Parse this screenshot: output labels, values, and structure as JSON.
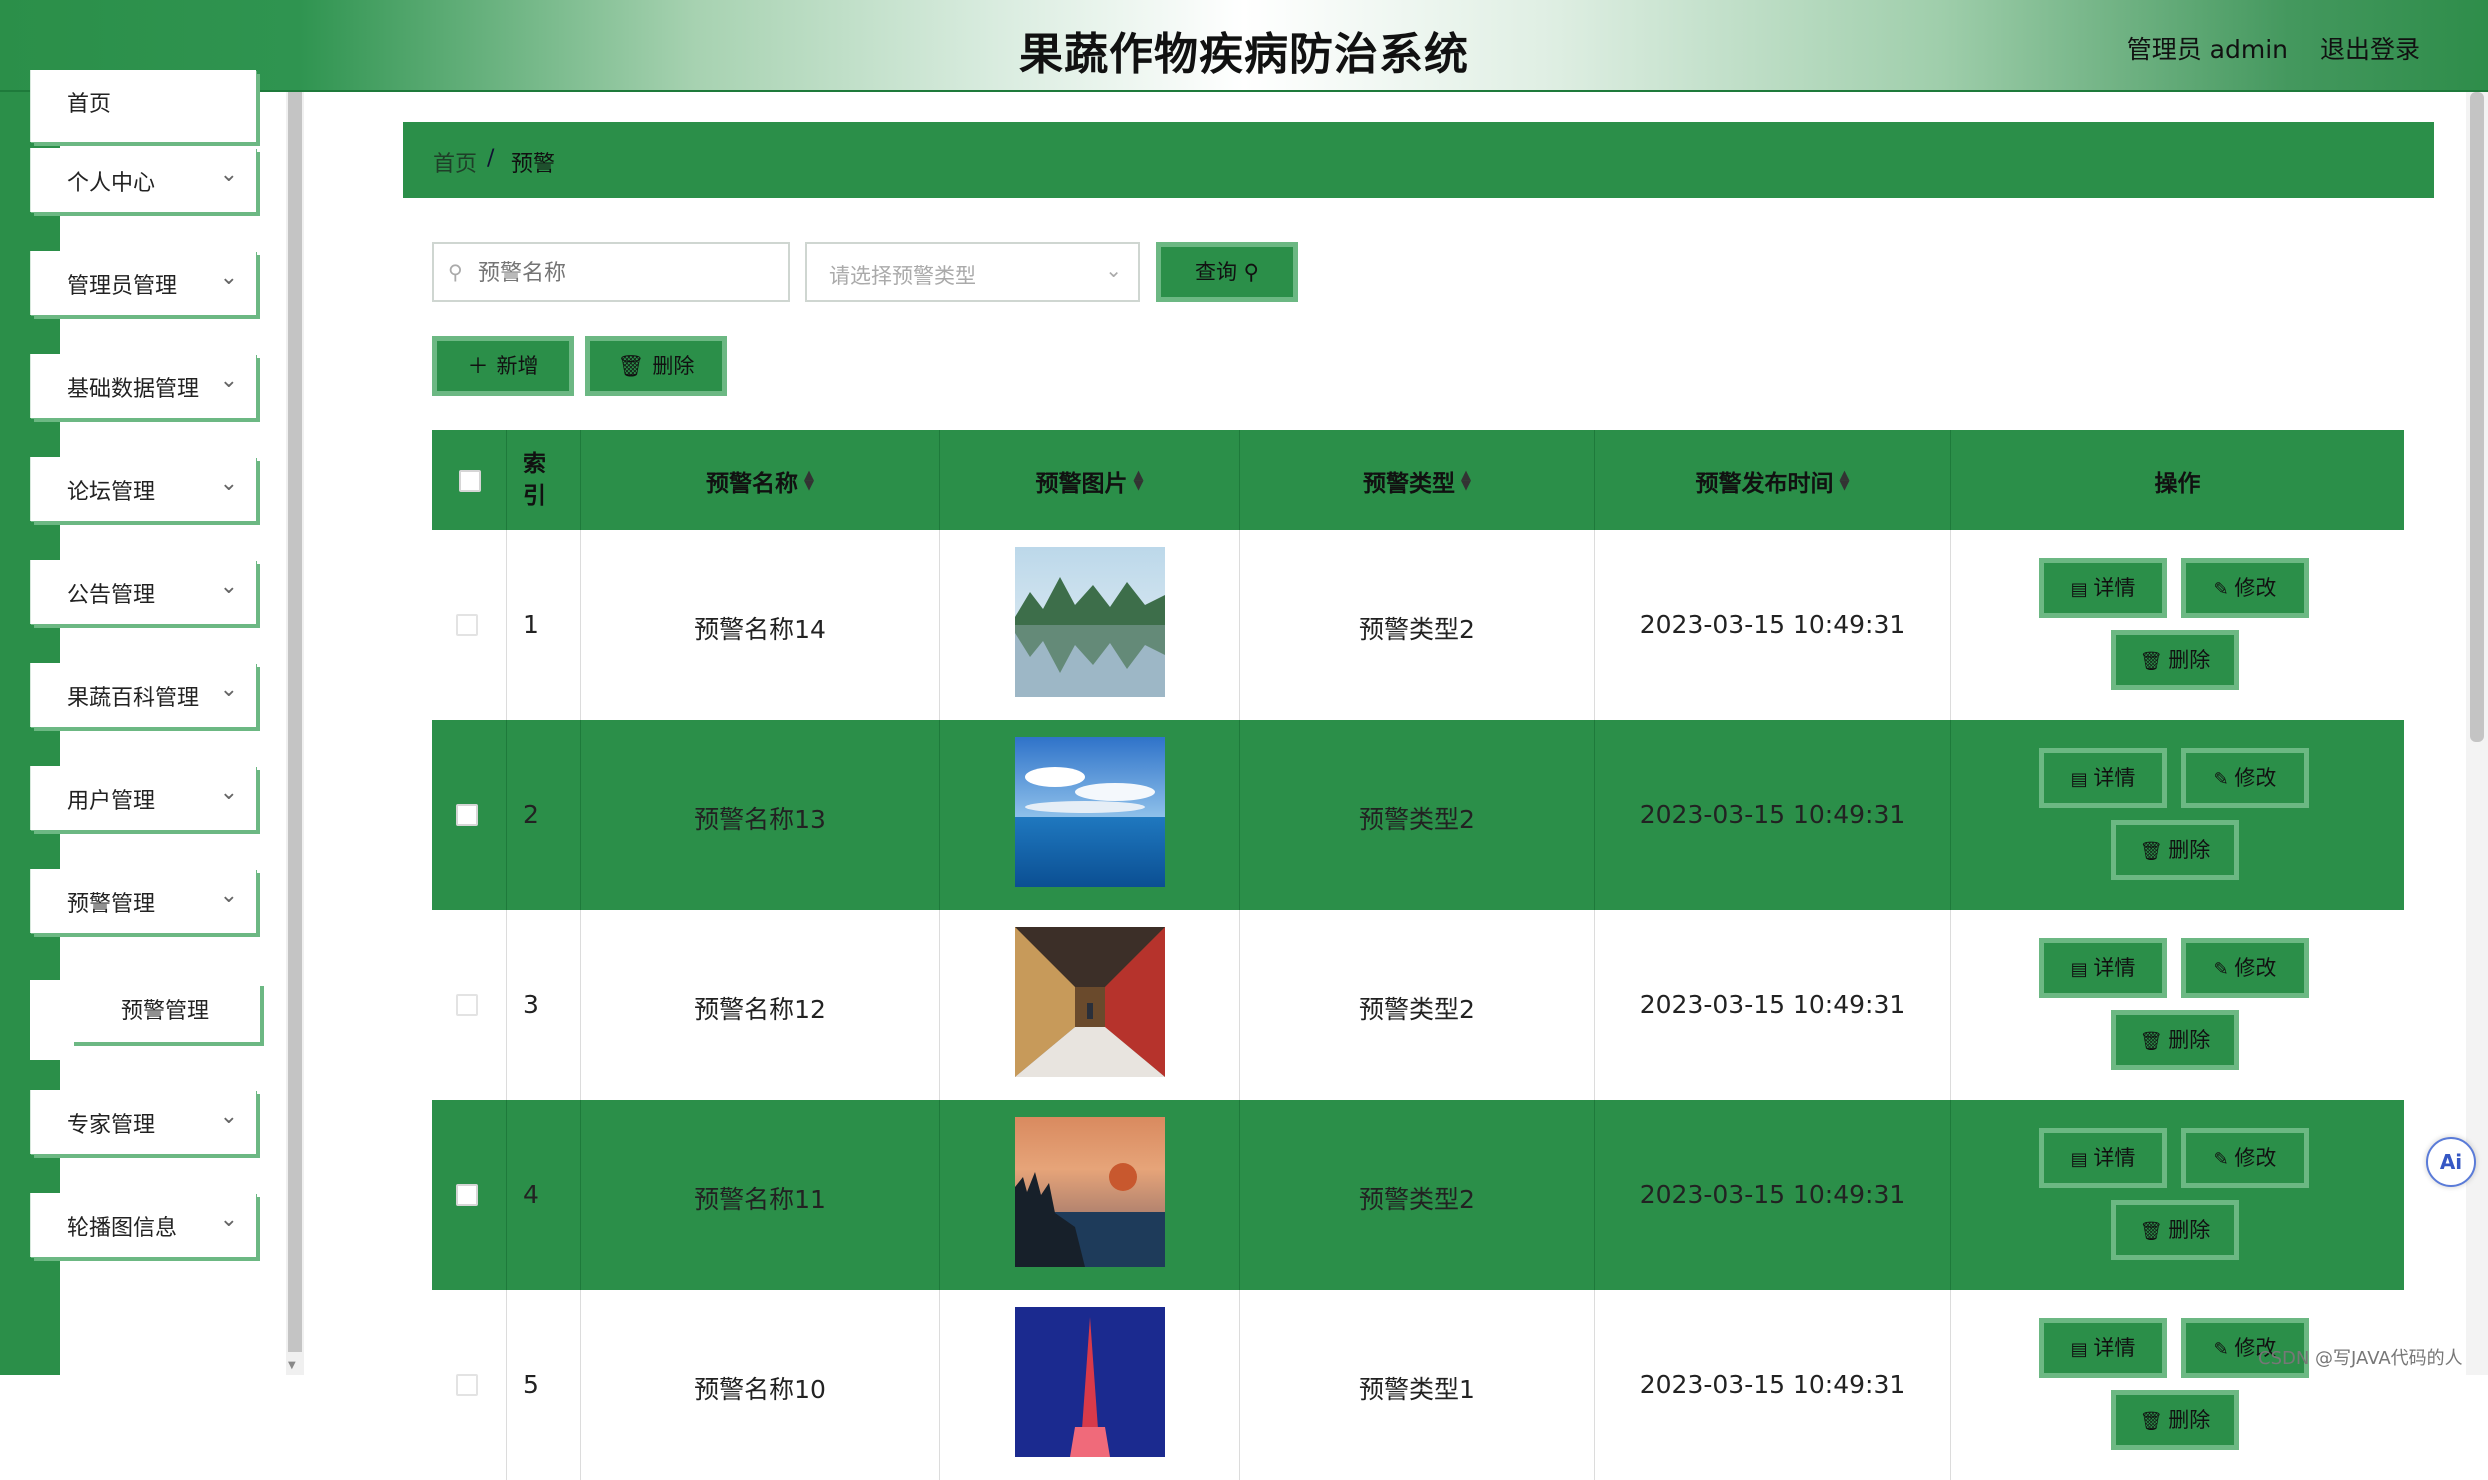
{
  "header": {
    "title": "果蔬作物疾病防治系统",
    "admin": "管理员 admin",
    "logout": "退出登录"
  },
  "sidebar": {
    "items": [
      {
        "label": "首页"
      },
      {
        "label": "个人中心"
      },
      {
        "label": "管理员管理"
      },
      {
        "label": "基础数据管理"
      },
      {
        "label": "论坛管理"
      },
      {
        "label": "公告管理"
      },
      {
        "label": "果蔬百科管理"
      },
      {
        "label": "用户管理"
      },
      {
        "label": "预警管理"
      },
      {
        "label": "专家管理"
      },
      {
        "label": "轮播图信息"
      }
    ],
    "sub_item": "预警管理"
  },
  "breadcrumb": {
    "home": "首页",
    "separator": "/",
    "current": "预警"
  },
  "filters": {
    "name_placeholder": "预警名称",
    "type_placeholder": "请选择预警类型",
    "query_label": "查询"
  },
  "actions": {
    "add_label": "新增",
    "delete_label": "删除"
  },
  "table": {
    "headers": {
      "index": "索引",
      "name": "预警名称",
      "image": "预警图片",
      "type": "预警类型",
      "time": "预警发布时间",
      "ops": "操作"
    },
    "buttons": {
      "detail": "详情",
      "edit": "修改",
      "delete": "删除"
    },
    "rows": [
      {
        "index": "1",
        "name": "预警名称14",
        "type": "预警类型2",
        "time": "2023-03-15 10:49:31",
        "image": "mountain-lake"
      },
      {
        "index": "2",
        "name": "预警名称13",
        "type": "预警类型2",
        "time": "2023-03-15 10:49:31",
        "image": "sea-sky"
      },
      {
        "index": "3",
        "name": "预警名称12",
        "type": "预警类型2",
        "time": "2023-03-15 10:49:31",
        "image": "corridor"
      },
      {
        "index": "4",
        "name": "预警名称11",
        "type": "预警类型2",
        "time": "2023-03-15 10:49:31",
        "image": "sunset-lake"
      },
      {
        "index": "5",
        "name": "预警名称10",
        "type": "预警类型1",
        "time": "2023-03-15 10:49:31",
        "image": "tower-night"
      }
    ]
  },
  "watermark": "CSDN @写JAVA代码的人",
  "ai_badge": "Ai",
  "colors": {
    "primary": "#2b8f49",
    "accent_border": "#6cb883"
  }
}
